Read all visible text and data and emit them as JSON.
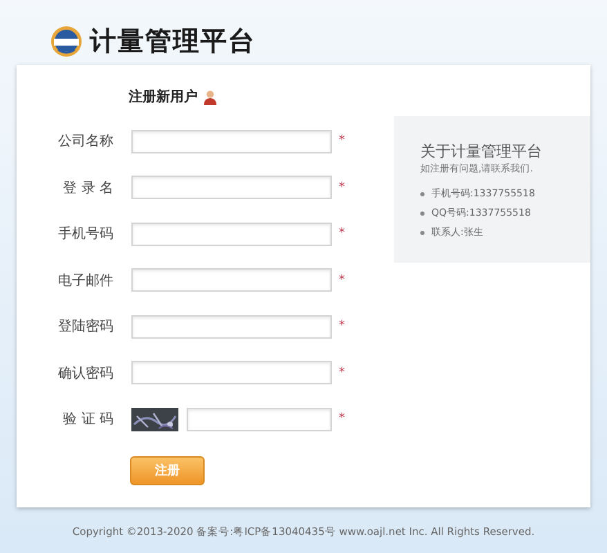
{
  "header": {
    "title": "计量管理平台"
  },
  "form": {
    "title": "注册新用户",
    "fields": [
      {
        "label": "公司名称",
        "kind": "text",
        "required": true
      },
      {
        "label": "登 录 名",
        "kind": "text",
        "required": true
      },
      {
        "label": "手机号码",
        "kind": "text",
        "required": true
      },
      {
        "label": "电子邮件",
        "kind": "text",
        "required": true
      },
      {
        "label": "登陆密码",
        "kind": "password",
        "required": true
      },
      {
        "label": "确认密码",
        "kind": "password",
        "required": true
      },
      {
        "label": "验 证 码",
        "kind": "captcha",
        "required": true
      }
    ],
    "required_mark": "*",
    "submit": "注册"
  },
  "about": {
    "title": "关于计量管理平台",
    "intro": "如注册有问题,请联系我们.",
    "items": [
      "手机号码:1337755518",
      "QQ号码:1337755518",
      "联系人:张生"
    ]
  },
  "footer": "Copyright ©2013-2020 备案号:粤ICP备13040435号 www.oajl.net Inc. All Rights Reserved."
}
